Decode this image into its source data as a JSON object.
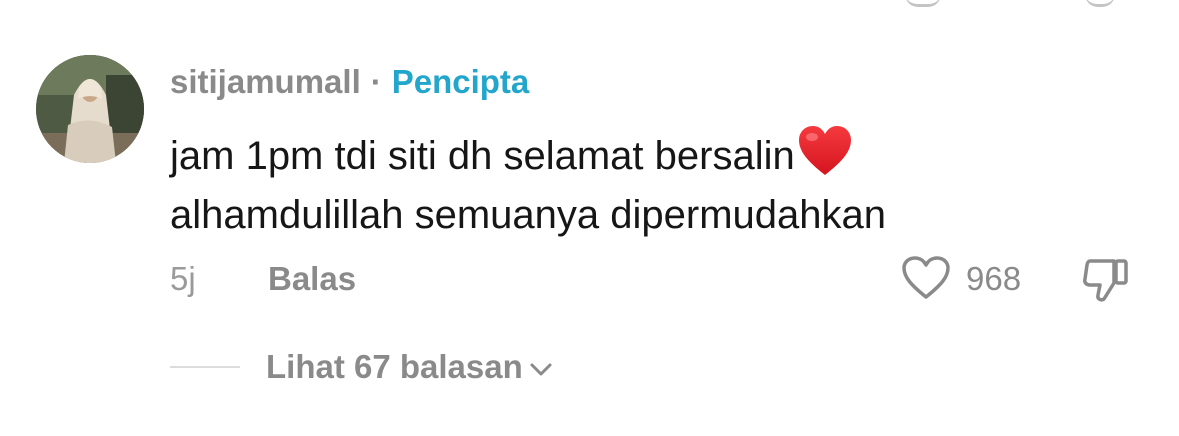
{
  "comment": {
    "username": "sitijamumall",
    "separator": "·",
    "creator_badge": "Pencipta",
    "text_line_1": "jam 1pm tdi siti dh selamat bersalin",
    "text_line_2": "alhamdulillah semuanya dipermudahkan",
    "emoji": "red-heart",
    "time_ago": "5j",
    "reply_label": "Balas",
    "like_count": "968",
    "view_replies_label": "Lihat 67 balasan"
  },
  "icons": {
    "like": "heart-outline-icon",
    "dislike": "thumbs-down-icon",
    "expand": "chevron-down-icon"
  },
  "colors": {
    "creator_badge": "#23a6cc",
    "muted_text": "#8a8a8a",
    "body_text": "#161616",
    "emoji_heart": "#e0202c"
  }
}
